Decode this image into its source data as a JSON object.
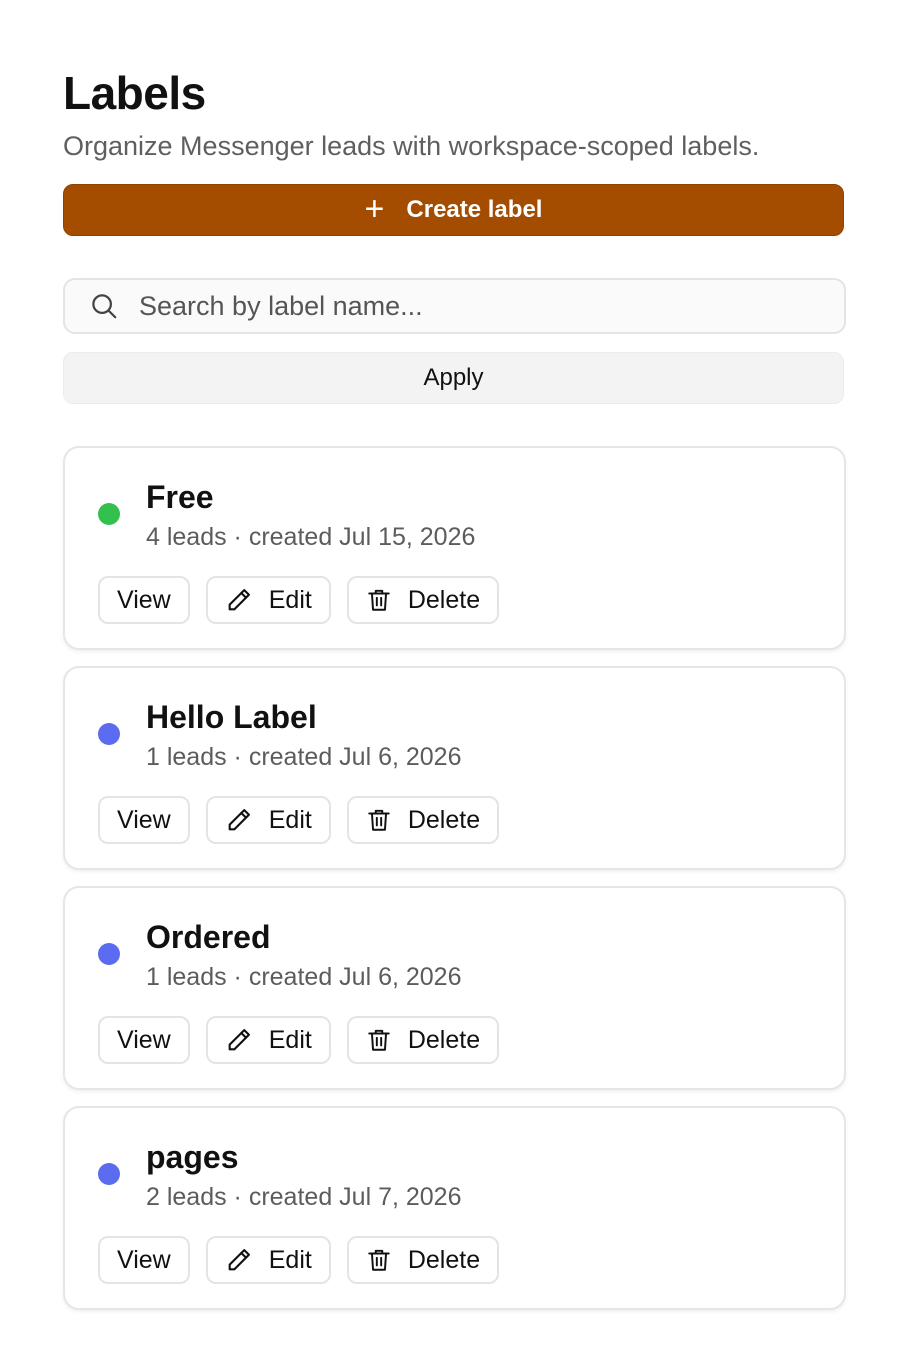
{
  "header": {
    "title": "Labels",
    "subtitle": "Organize Messenger leads with workspace-scoped labels."
  },
  "create_button": {
    "icon": "plus-icon",
    "label": "Create label"
  },
  "search": {
    "icon": "search-icon",
    "placeholder": "Search by label name...",
    "value": ""
  },
  "apply_button": {
    "label": "Apply"
  },
  "colors": {
    "accent": "#a44c00",
    "green": "#34c04f",
    "blue": "#5b6cf0"
  },
  "labels": [
    {
      "name": "Free",
      "meta": "4 leads · created Jul 15, 2026",
      "color": "#34c04f",
      "actions": {
        "view": "View",
        "edit": "Edit",
        "delete": "Delete"
      }
    },
    {
      "name": "Hello Label",
      "meta": "1 leads · created Jul 6, 2026",
      "color": "#5b6cf0",
      "actions": {
        "view": "View",
        "edit": "Edit",
        "delete": "Delete"
      }
    },
    {
      "name": "Ordered",
      "meta": "1 leads · created Jul 6, 2026",
      "color": "#5b6cf0",
      "actions": {
        "view": "View",
        "edit": "Edit",
        "delete": "Delete"
      }
    },
    {
      "name": "pages",
      "meta": "2 leads · created Jul 7, 2026",
      "color": "#5b6cf0",
      "actions": {
        "view": "View",
        "edit": "Edit",
        "delete": "Delete"
      }
    }
  ]
}
